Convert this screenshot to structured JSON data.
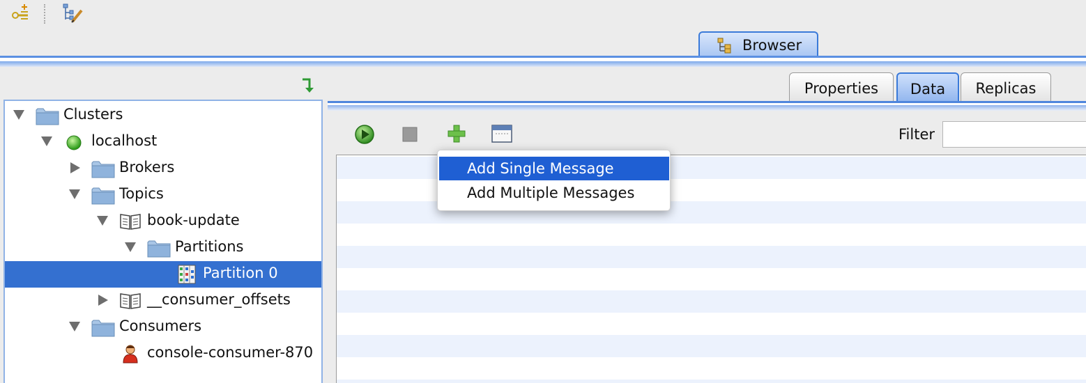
{
  "top_toolbar": {
    "icons": [
      "add-connection-icon",
      "edit-tree-icon"
    ]
  },
  "main_tab": {
    "label": "Browser"
  },
  "tree": {
    "nodes": [
      {
        "label": "Clusters",
        "icon": "folder-icon",
        "expanded": true
      },
      {
        "label": "localhost",
        "icon": "green-status-icon",
        "expanded": true
      },
      {
        "label": "Brokers",
        "icon": "folder-icon",
        "expanded": false
      },
      {
        "label": "Topics",
        "icon": "folder-icon",
        "expanded": true
      },
      {
        "label": "book-update",
        "icon": "book-icon",
        "expanded": true
      },
      {
        "label": "Partitions",
        "icon": "folder-icon",
        "expanded": true
      },
      {
        "label": "Partition 0",
        "icon": "partition-icon",
        "selected": true
      },
      {
        "label": "__consumer_offsets",
        "icon": "book-icon",
        "expanded": false
      },
      {
        "label": "Consumers",
        "icon": "folder-icon",
        "expanded": true
      },
      {
        "label": "console-consumer-870",
        "icon": "consumer-person-icon"
      }
    ]
  },
  "sub_tabs": {
    "properties": "Properties",
    "data": "Data",
    "replicas": "Replicas",
    "active": "Data"
  },
  "data_toolbar": {
    "icons": [
      "play-icon",
      "stop-icon",
      "add-icon",
      "window-icon"
    ],
    "filter_label": "Filter",
    "filter_value": ""
  },
  "popup_menu": {
    "items": [
      "Add Single Message",
      "Add Multiple Messages"
    ],
    "highlighted_index": 0
  },
  "colors": {
    "selection": "#3470d0",
    "menu_highlight": "#1f5fd3",
    "tab_blue": "#3a7ad9",
    "stripe": "#ecf2fd"
  }
}
